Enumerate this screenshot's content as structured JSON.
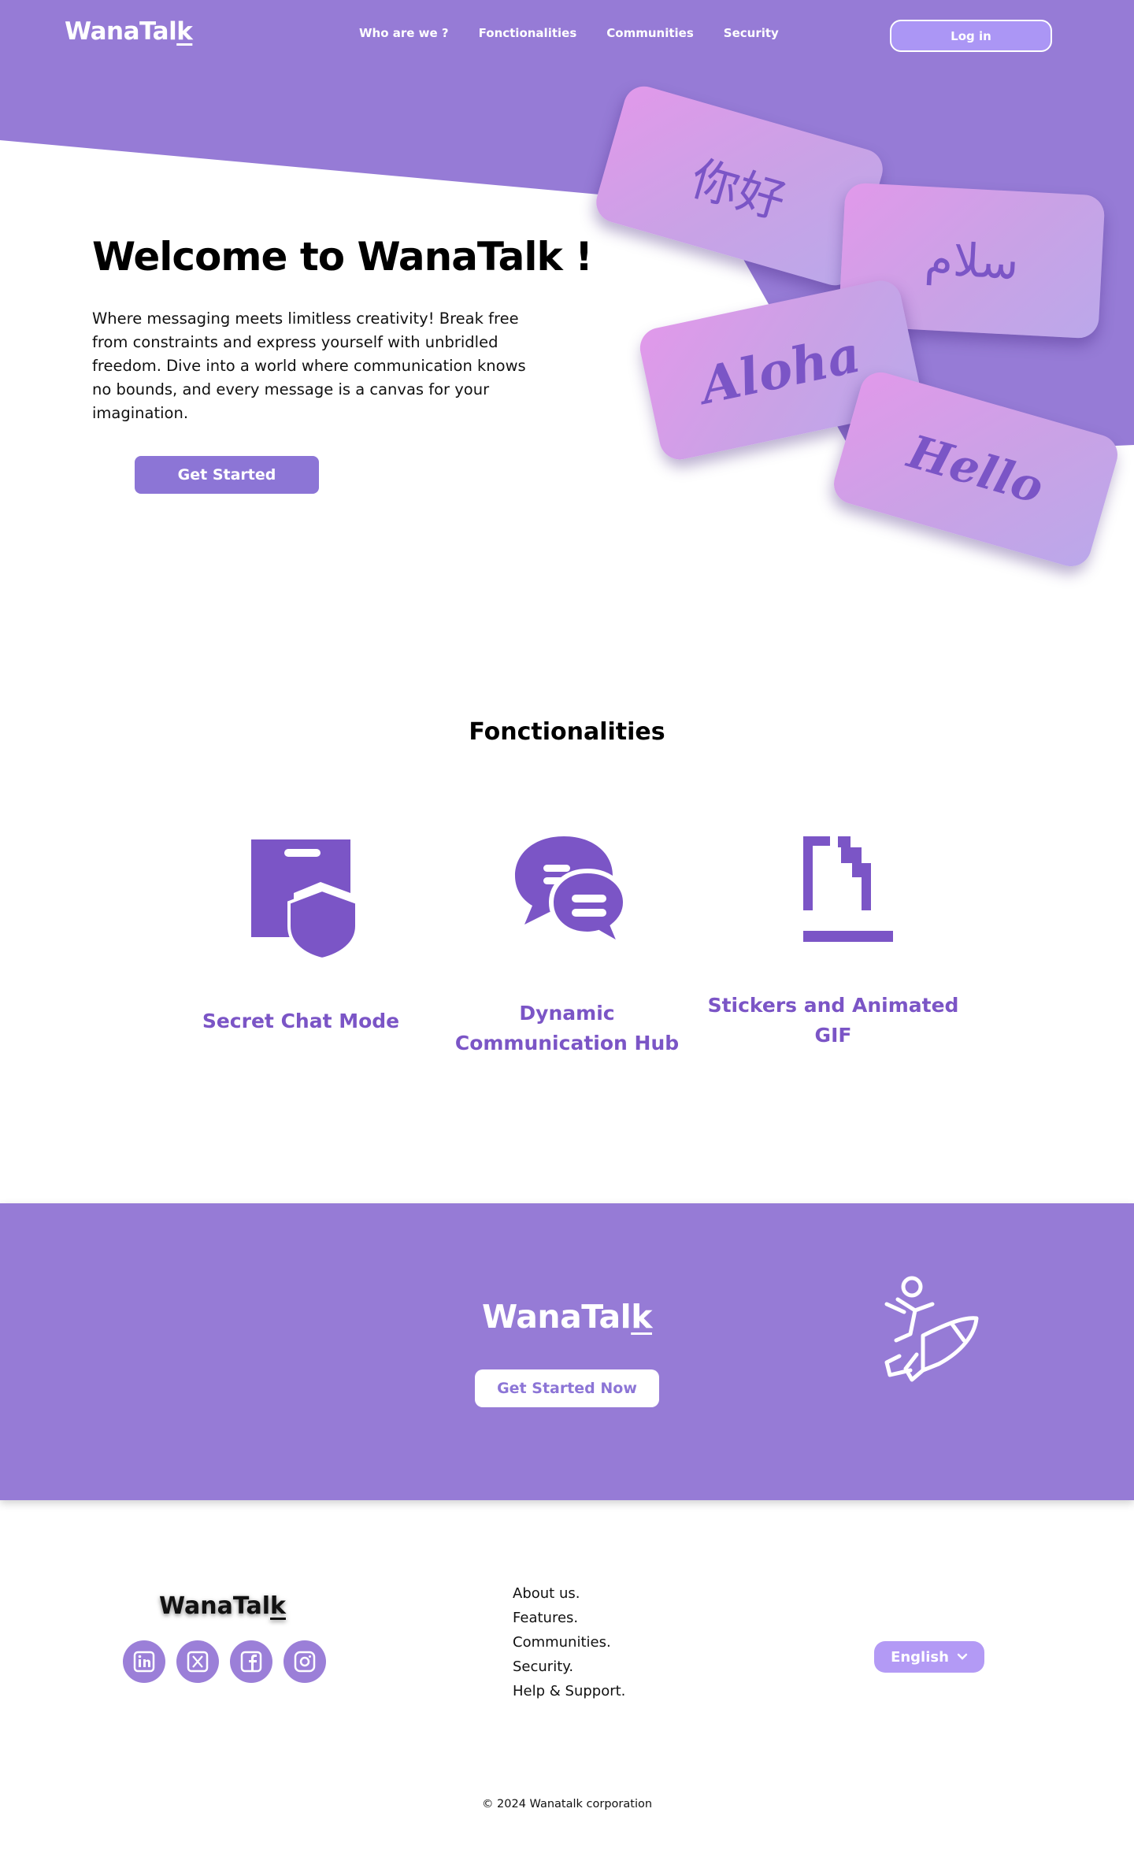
{
  "colors": {
    "primary": "#967bd6",
    "accent": "#7b55c6",
    "button": "#8c75d6",
    "light_accent": "#b39af5",
    "card_pink": "#e199ea",
    "white": "#ffffff"
  },
  "header": {
    "logo": "WanaTal",
    "logo_k": "k",
    "nav": [
      "Who are we ?",
      "Fonctionalities",
      "Communities",
      "Security"
    ],
    "login_label": "Log in"
  },
  "hero": {
    "title": "Welcome to WanaTalk !",
    "text": "Where messaging meets limitless creativity! Break free from constraints and express yourself with unbridled freedom. Dive into a world where communication knows no bounds, and every message is a canvas for your imagination.",
    "cta_label": "Get Started",
    "greetings": [
      "你好",
      "سلام",
      "Aloha",
      "Hello"
    ]
  },
  "features": {
    "title": "Fonctionalities",
    "items": [
      {
        "label": "Secret Chat Mode",
        "icon": "secret-chat-icon"
      },
      {
        "label": "Dynamic Communication Hub",
        "icon": "chat-bubbles-icon"
      },
      {
        "label": "Stickers and Animated GIF",
        "icon": "sticker-icon"
      }
    ]
  },
  "cta_band": {
    "logo": "WanaTal",
    "logo_k": "k",
    "button_label": "Get Started Now",
    "icon": "rocket-rider-icon"
  },
  "footer": {
    "logo": "WanaTal",
    "logo_k": "k",
    "socials": [
      "linkedin-icon",
      "x-icon",
      "facebook-icon",
      "instagram-icon"
    ],
    "links": [
      "About us.",
      "Features.",
      "Communities.",
      "Security.",
      "Help & Support."
    ],
    "language": "English",
    "copyright": "© 2024 Wanatalk corporation"
  }
}
